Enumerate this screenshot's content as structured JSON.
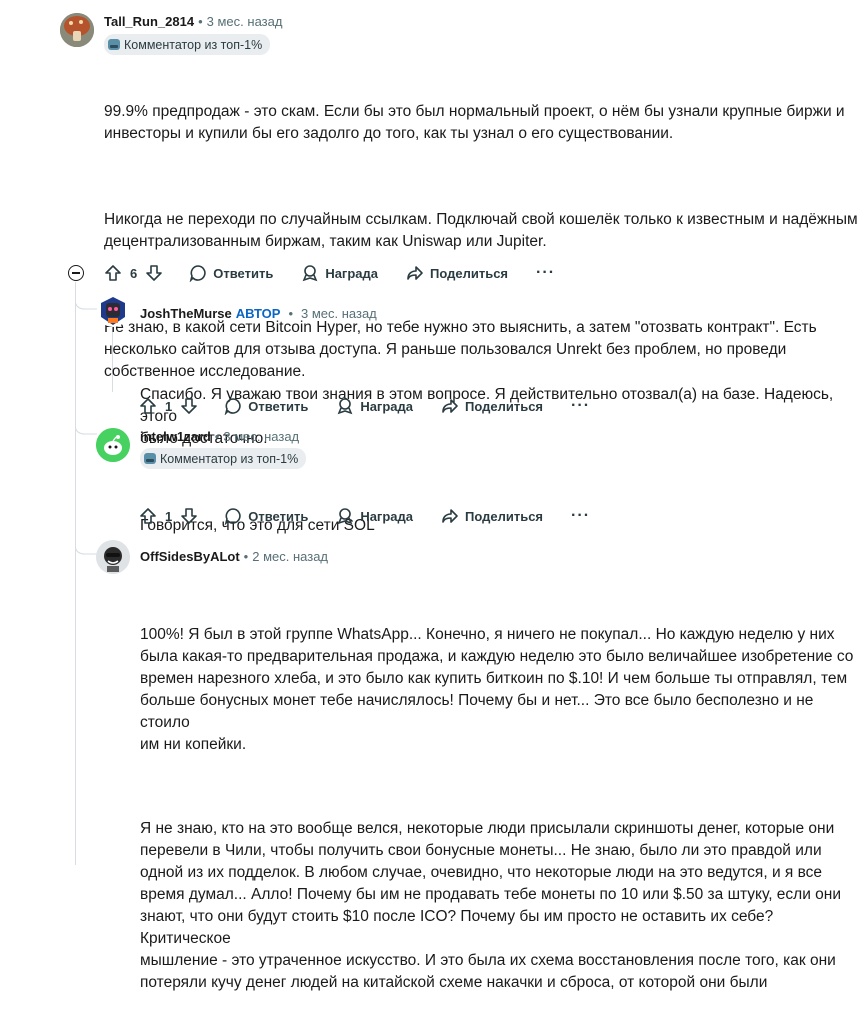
{
  "comments": [
    {
      "username": "Tall_Run_2814",
      "time": "3 мес. назад",
      "badge": "Комментатор из топ-1%",
      "paragraphs": [
        "99.9% предпродаж - это скам. Если бы это был нормальный проект, о нём бы узнали крупные биржи и\nинвесторы и купили бы его задолго до того, как ты узнал о его существовании.",
        "Никогда не переходи по случайным ссылкам. Подключай свой кошелёк только к известным и надёжным\nдецентрализованным биржам, таким как Uniswap или Jupiter.",
        "Не знаю, в какой сети Bitcoin Hyper, но тебе нужно это выяснить, а затем \"отозвать контракт\". Есть\nнесколько сайтов для отзыва доступа. Я раньше пользовался Unrekt без проблем, но проведи\nсобственное исследование."
      ],
      "votes": "6"
    },
    {
      "username": "JoshTheMurse",
      "author_tag": "АВТОР",
      "time": "3 мес. назад",
      "paragraphs": [
        "Спасибо. Я уважаю твои знания в этом вопросе. Я действительно отозвал(а) на базе. Надеюсь, этого\nбыло достаточно."
      ],
      "votes": "1"
    },
    {
      "username": "intelw1zard",
      "time": "3 мес. назад",
      "badge": "Комментатор из топ-1%",
      "paragraphs": [
        "Говорится, что это для сети SOL"
      ],
      "votes": "1"
    },
    {
      "username": "OffSidesByALot",
      "time": "2 мес. назад",
      "paragraphs": [
        "100%! Я был в этой группе WhatsApp... Конечно, я ничего не покупал... Но каждую неделю у них\nбыла какая-то предварительная продажа, и каждую неделю это было величайшее изобретение со\nвремен нарезного хлеба, и это было как купить биткоин по $.10! И чем больше ты отправлял, тем\nбольше бонусных монет тебе начислялось! Почему бы и нет... Это все было бесполезно и не стоило\nим ни копейки.",
        "Я не знаю, кто на это вообще велся, некоторые люди присылали скриншоты денег, которые они\nперевели в Чили, чтобы получить свои бонусные монеты... Не знаю, было ли это правдой или\nодной из их подделок. В любом случае, очевидно, что некоторые люди на это ведутся, и я все\nвремя думал... Алло! Почему бы им не продавать тебе монеты по 10 или $.50 за штуку, если они\nзнают, что они будут стоить $10 после ICO? Почему бы им просто не оставить их себе? Критическое\nмышление - это утраченное искусство. И это была их схема восстановления после того, как они\nпотеряли кучу денег людей на китайской схеме накачки и сброса, от которой они были"
      ]
    }
  ],
  "actions": {
    "reply": "Ответить",
    "award": "Награда",
    "share": "Поделиться",
    "more": "···"
  }
}
